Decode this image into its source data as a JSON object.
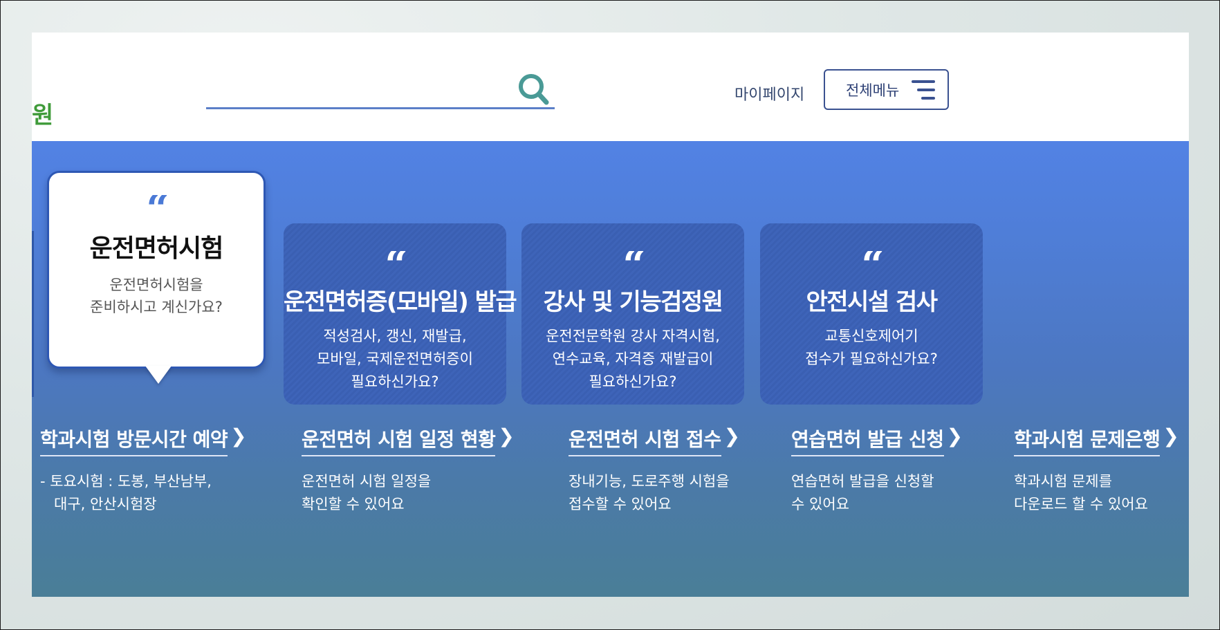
{
  "header": {
    "logo_fragment": "원",
    "search": {
      "value": "",
      "placeholder": ""
    },
    "mypage_label": "마이페이지",
    "all_menu_label": "전체메뉴"
  },
  "featured": {
    "title": "운전면허시험",
    "desc_lines": [
      "운전면허시험을",
      "준비하시고 계신가요?"
    ]
  },
  "cards": [
    {
      "title": "운전면허증(모바일) 발급",
      "desc_lines": [
        "적성검사, 갱신, 재발급,",
        "모바일, 국제운전면허증이",
        "필요하신가요?"
      ]
    },
    {
      "title": "강사 및 기능검정원",
      "desc_lines": [
        "운전전문학원 강사 자격시험,",
        "연수교육, 자격증 재발급이",
        "필요하신가요?"
      ]
    },
    {
      "title": "안전시설 검사",
      "desc_lines": [
        "교통신호제어기",
        "접수가 필요하신가요?"
      ]
    }
  ],
  "quick_links": [
    {
      "title": "학과시험 방문시간 예약",
      "desc_lines": [
        "- 토요시험 : 도봉, 부산남부,",
        "   대구, 안산시험장"
      ]
    },
    {
      "title": "운전면허 시험 일정 현황",
      "desc_lines": [
        "운전면허 시험 일정을",
        "확인할 수 있어요"
      ]
    },
    {
      "title": "운전면허 시험 접수",
      "desc_lines": [
        "장내기능, 도로주행 시험을",
        "접수할 수 있어요"
      ]
    },
    {
      "title": "연습면허 발급 신청",
      "desc_lines": [
        "연습면허 발급을 신청할",
        "수 있어요"
      ]
    },
    {
      "title": "학과시험 문제은행",
      "desc_lines": [
        "학과시험 문제를",
        "다운로드 할 수 있어요"
      ]
    }
  ],
  "colors": {
    "accent_blue": "#5282e4",
    "card_blue": "#3e64b9",
    "logo_green": "#3f9b3a",
    "search_icon": "#4a9a96"
  },
  "icons": {
    "search": "search-icon",
    "menu": "hamburger-menu-icon",
    "quote": "quote-icon",
    "chevron": "chevron-right-icon"
  }
}
